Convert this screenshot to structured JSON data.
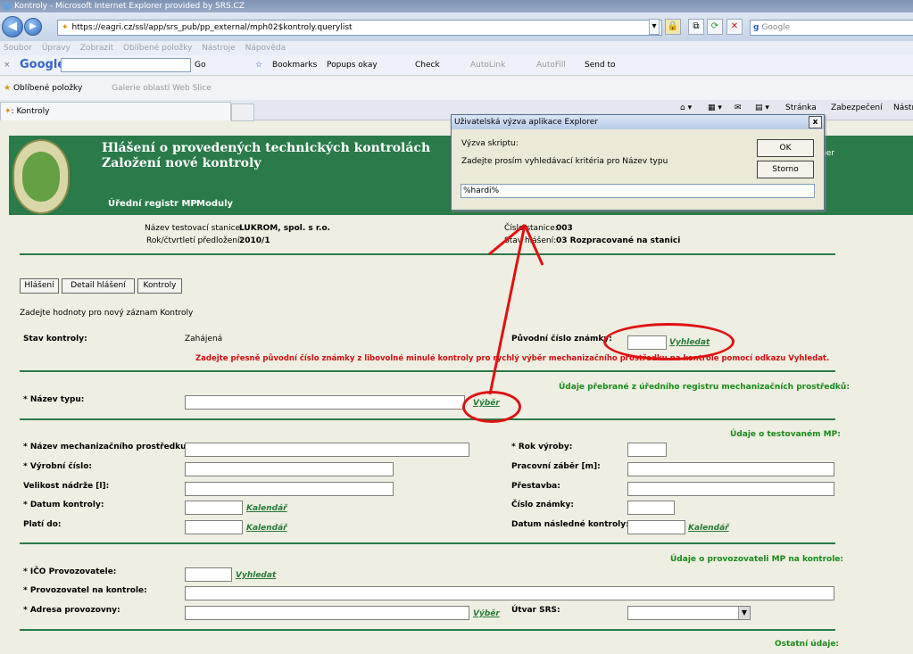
{
  "browser": {
    "window_title": "Kontroly - Microsoft Internet Explorer provided by SRS.CZ",
    "address": "https://eagri.cz/ssl/app/srs_pub/pp_external/mph02$kontroly.querylist",
    "search_placeholder": "Google",
    "menu": [
      "Soubor",
      "Úpravy",
      "Zobrazit",
      "Oblíbené položky",
      "Nástroje",
      "Nápověda"
    ],
    "gtoolbar": {
      "google": "Google",
      "go": "Go",
      "bookmarks": "Bookmarks",
      "popups": "Popups okay",
      "check": "Check",
      "autolink": "AutoLink",
      "autofill": "AutoFill",
      "sendto": "Send to"
    },
    "favorites": {
      "label": "Oblíbené položky",
      "gallery": "Galerie oblastí Web Slice"
    },
    "tab_title": ": Kontroly",
    "cmdbar": {
      "stranka": "Stránka",
      "zabezpeceni": "Zabezpečení",
      "nastroje": "Nástr"
    }
  },
  "header": {
    "title1": "Hlášení o provedených technických kontrolách",
    "title2": "Založení nové kontroly",
    "nav": [
      "Úřední registr MP",
      "Moduly"
    ],
    "right_fragment": "ner"
  },
  "dialog": {
    "title": "Uživatelská výzva aplikace Explorer",
    "prompt_label": "Výzva skriptu:",
    "prompt_text": "Zadejte prosím vyhledávací kritéria pro Název typu",
    "value": "%hardi%",
    "ok": "OK",
    "cancel": "Storno",
    "close": "x"
  },
  "info": {
    "station_label": "Název testovací stanice:",
    "station_value": "LUKROM, spol. s r.o.",
    "period_label": "Rok/čtvrtletí předložení:",
    "period_value": "2010/1",
    "number_label": "Číslo stanice:",
    "number_value": "003",
    "state_label": "Stav hlášení:",
    "state_value": "03 Rozpracované na stanici"
  },
  "subnav": [
    "Hlášení",
    "Detail hlášení",
    "Kontroly"
  ],
  "form": {
    "intro": "Zadejte hodnoty pro nový záznam Kontroly",
    "stav_label": "Stav kontroly:",
    "stav_value": "Zahájená",
    "puvodni_label": "Původní číslo známky:",
    "vyhledat": "Vyhledat",
    "warning": "Zadejte přesně původní číslo známky z libovolné minulé kontroly pro rychlý výběr mechanizačního prostředku na kontrole pomocí odkazu Vyhledat.",
    "section1": "Údaje přebrané z úředního registru mechanizačních prostředků:",
    "nazev_typu": "* Název typu:",
    "vyber": "Výběr",
    "section2": "Údaje o testovaném MP:",
    "nazev_mp": "* Název mechanizačního prostředku:",
    "rok_vyroby": "* Rok výroby:",
    "vyrobni_cislo": "* Výrobní číslo:",
    "pracovni_zaber": "Pracovní záběr [m]:",
    "velikost_nadrze": "Velikost nádrže [l]:",
    "prestavba": "Přestavba:",
    "datum_kontroly": "* Datum kontroly:",
    "cislo_znamky": "Číslo známky:",
    "plati_do": "Platí do:",
    "datum_nasledne": "Datum následné kontroly:",
    "kalendar": "Kalendář",
    "section3": "Údaje o provozovateli MP na kontrole:",
    "ico": "* IČO Provozovatele:",
    "provozovatel": "* Provozovatel na kontrole:",
    "adresa": "* Adresa provozovny:",
    "utvar": "Útvar SRS:",
    "section4": "Ostatní údaje:"
  }
}
